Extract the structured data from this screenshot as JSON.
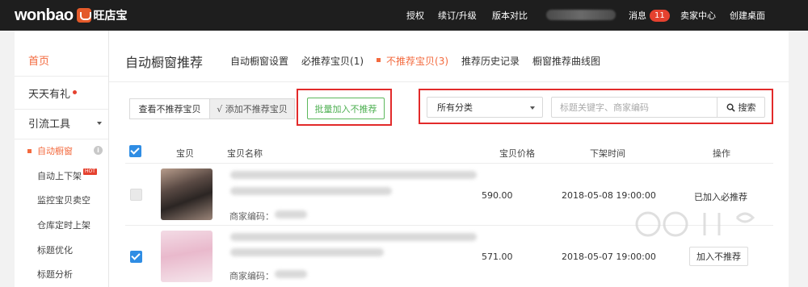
{
  "header": {
    "logo_text": "wonbao",
    "logo_cn": "旺店宝",
    "nav": [
      {
        "label": "授权"
      },
      {
        "label": "续订/升级"
      },
      {
        "label": "版本对比"
      }
    ],
    "messages_label": "消息",
    "messages_count": "11",
    "seller_center": "卖家中心",
    "create_desktop": "创建桌面"
  },
  "sidebar": {
    "home": "首页",
    "daily_gift": "天天有礼",
    "traffic_tools": "引流工具",
    "sub_items": [
      {
        "label": "自动橱窗",
        "active": true
      },
      {
        "label": "自动上下架",
        "tag": "HOT"
      },
      {
        "label": "监控宝贝卖空"
      },
      {
        "label": "仓库定时上架"
      },
      {
        "label": "标题优化"
      },
      {
        "label": "标题分析"
      }
    ]
  },
  "main": {
    "title": "自动橱窗推荐",
    "tabs": [
      {
        "label": "自动橱窗设置"
      },
      {
        "label": "必推荐宝贝(1)"
      },
      {
        "label": "不推荐宝贝(3)",
        "active": true
      },
      {
        "label": "推荐历史记录"
      },
      {
        "label": "橱窗推荐曲线图"
      }
    ],
    "filters": {
      "view_not_recommended": "查看不推荐宝贝",
      "add_not_recommended": "√ 添加不推荐宝贝",
      "batch_add": "批量加入不推荐",
      "category_selected": "所有分类",
      "search_placeholder": "标题关键字、商家编码",
      "search_button": "搜索"
    },
    "table": {
      "columns": [
        "宝贝",
        "宝贝名称",
        "宝贝价格",
        "下架时间",
        "操作"
      ],
      "merchant_code_label": "商家编码：",
      "rows": [
        {
          "price": "590.00",
          "offline_time": "2018-05-08 19:00:00",
          "action": "已加入必推荐",
          "checked": false
        },
        {
          "price": "571.00",
          "offline_time": "2018-05-07 19:00:00",
          "action": "加入不推荐",
          "checked": true
        }
      ]
    }
  },
  "colors": {
    "accent_orange": "#f36a3e",
    "highlight_red": "#e22a2a",
    "checkbox_blue": "#2f8de4",
    "green_button": "#4caf50"
  }
}
